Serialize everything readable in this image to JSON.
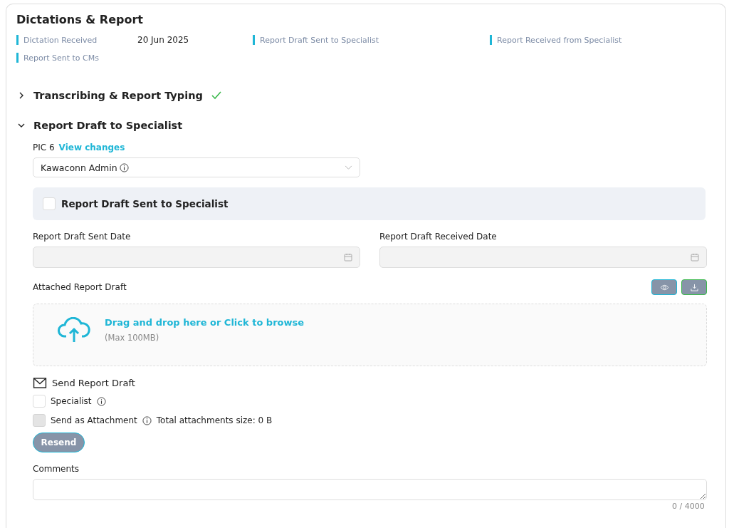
{
  "title": "Dictations & Report",
  "milestones": [
    {
      "label": "Dictation Received",
      "value": "20 Jun 2025"
    },
    {
      "label": "Report Draft Sent to Specialist"
    },
    {
      "label": "Report Received from Specialist"
    },
    {
      "label": "Report Sent to CMs"
    }
  ],
  "sections": [
    {
      "title": "Transcribing & Report Typing",
      "expanded": false,
      "completed": true
    },
    {
      "title": "Report Draft to Specialist",
      "expanded": true,
      "completed": false
    }
  ],
  "pic": {
    "label": "PIC 6",
    "link": "View changes",
    "value": "Kawaconn Admin"
  },
  "sent_checkbox": {
    "label": "Report Draft Sent to Specialist",
    "checked": false
  },
  "dates": [
    {
      "label": "Report Draft Sent Date",
      "disabled": true
    },
    {
      "label": "Report Draft Received Date",
      "disabled": true
    }
  ],
  "attachment": {
    "label": "Attached Report Draft",
    "prompt": "Drag and drop here or Click to browse",
    "hint": "(Max 100MB)"
  },
  "send": {
    "title": "Send Report Draft",
    "options": [
      {
        "label": "Specialist",
        "checked": false,
        "disabled": false
      },
      {
        "label": "Send as Attachment",
        "checked": false,
        "disabled": true,
        "note": "Total attachments size: 0 B"
      }
    ],
    "button": "Resend"
  },
  "comments": {
    "label": "Comments",
    "counter": "0 / 4000"
  }
}
